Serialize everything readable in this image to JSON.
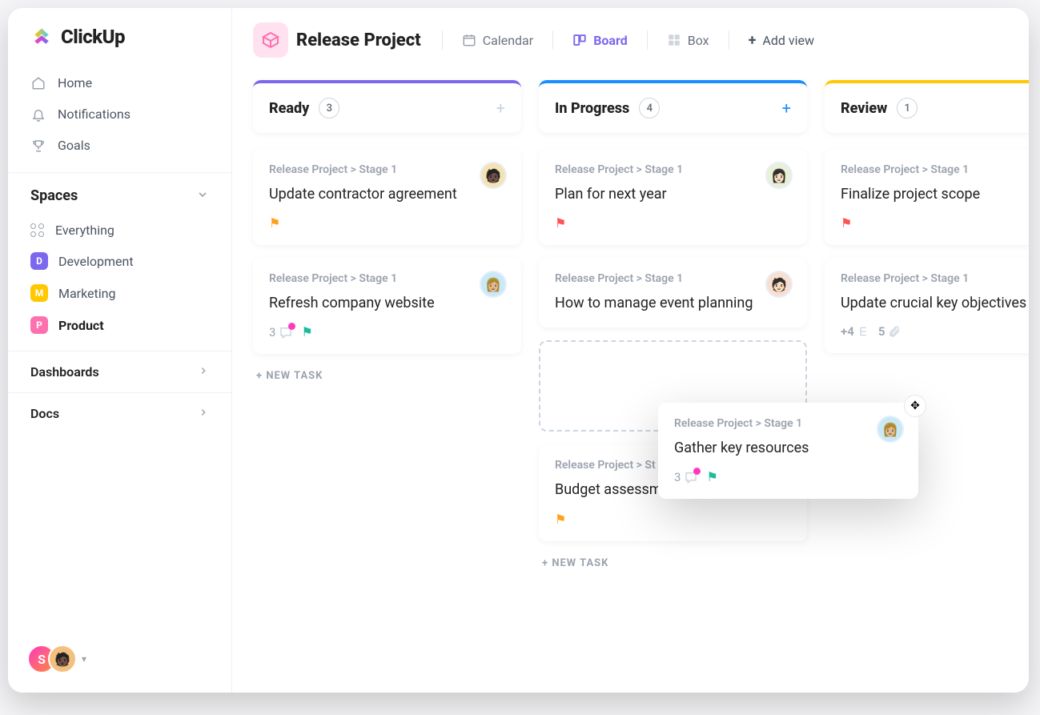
{
  "brand": "ClickUp",
  "nav": {
    "home": "Home",
    "notifications": "Notifications",
    "goals": "Goals"
  },
  "spaces": {
    "header": "Spaces",
    "everything": "Everything",
    "items": [
      {
        "letter": "D",
        "label": "Development"
      },
      {
        "letter": "M",
        "label": "Marketing"
      },
      {
        "letter": "P",
        "label": "Product"
      }
    ]
  },
  "rows": {
    "dashboards": "Dashboards",
    "docs": "Docs"
  },
  "avatar_letter": "S",
  "header": {
    "project_title": "Release Project",
    "views": {
      "calendar": "Calendar",
      "board": "Board",
      "box": "Box",
      "add": "Add view"
    }
  },
  "columns": {
    "ready": {
      "title": "Ready",
      "count": "3",
      "accent": "#7b68ee"
    },
    "inprogress": {
      "title": "In Progress",
      "count": "4",
      "accent": "#1a90ff"
    },
    "review": {
      "title": "Review",
      "count": "1",
      "accent": "#ffc800"
    }
  },
  "breadcrumb": "Release Project > Stage 1",
  "cards": {
    "ready1": "Update contractor agreement",
    "ready2": "Refresh company website",
    "ready2_comments": "3",
    "ip1": "Plan for next year",
    "ip2": "How to manage event planning",
    "ip3_partial": "Release Project > St",
    "ip3_title": "Budget assessment",
    "drag_title": "Gather key resources",
    "drag_comments": "3",
    "rev1": "Finalize project scope",
    "rev2": "Update crucial key objectives",
    "rev2_subtasks": "+4",
    "rev2_attach": "5"
  },
  "new_task": "+ NEW TASK"
}
